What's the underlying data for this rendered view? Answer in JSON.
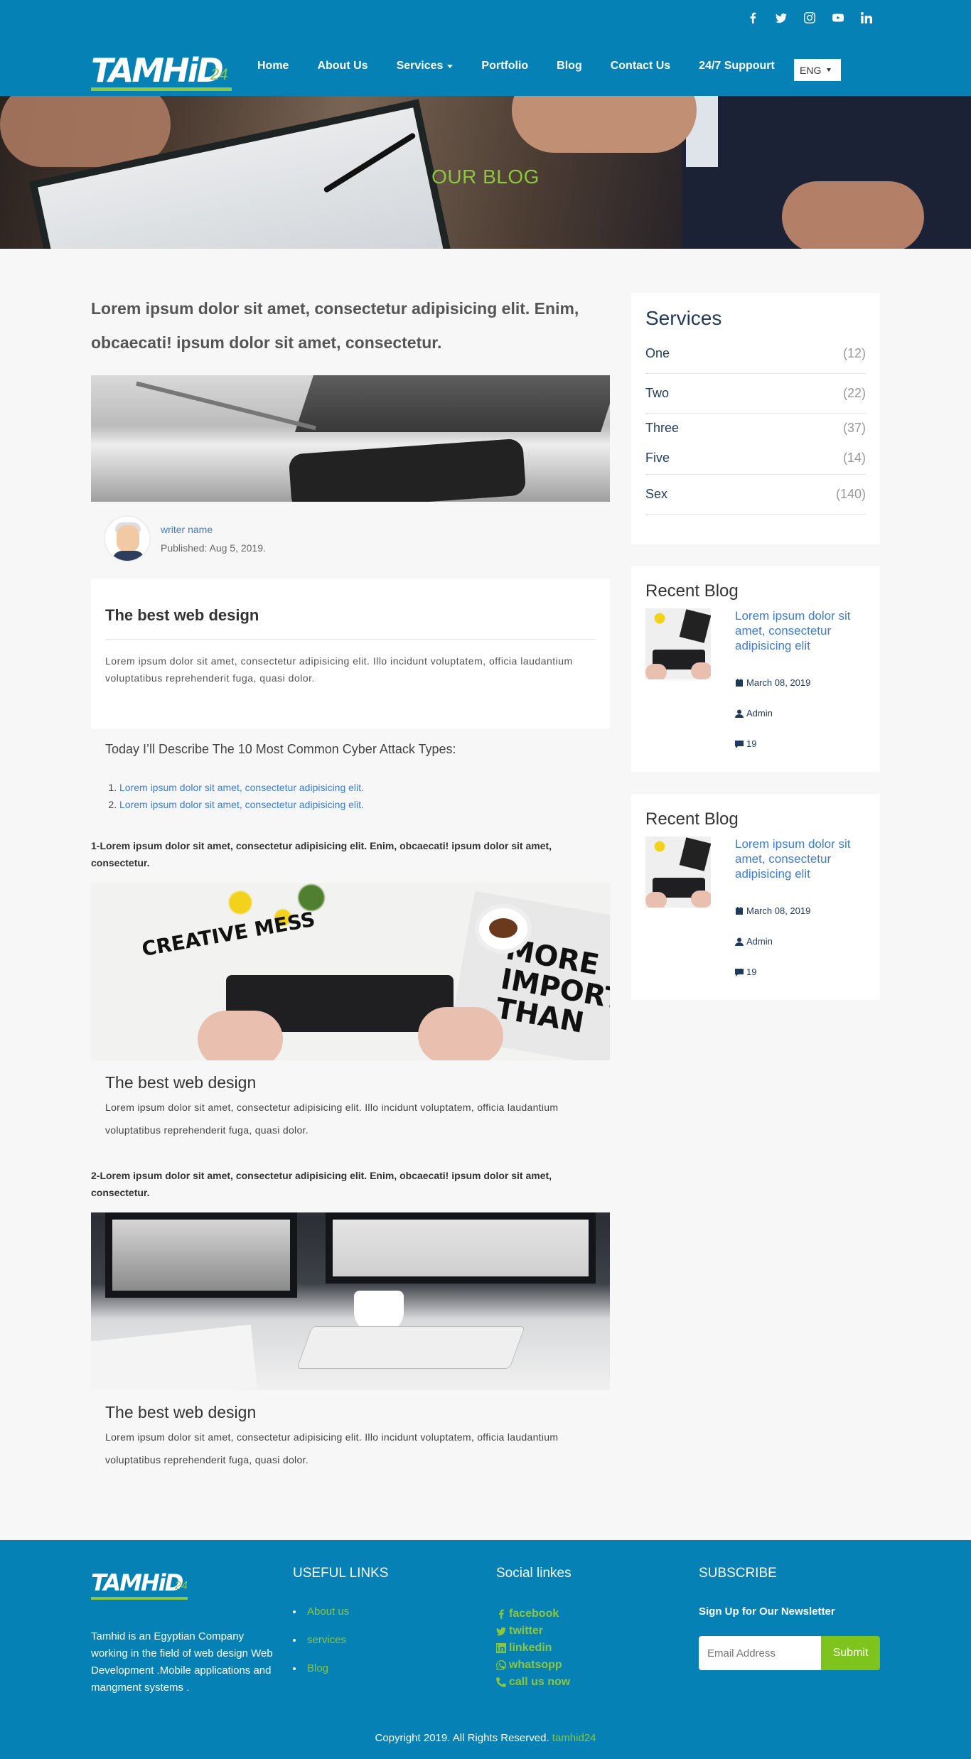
{
  "header": {
    "logo_text": "TAMHiD",
    "logo_sub": "24",
    "social_icons": [
      "facebook-icon",
      "twitter-icon",
      "instagram-icon",
      "youtube-icon",
      "linkedin-icon"
    ],
    "nav": [
      {
        "label": "Home"
      },
      {
        "label": "About Us"
      },
      {
        "label": "Services",
        "has_dropdown": true
      },
      {
        "label": "Portfolio"
      },
      {
        "label": "Blog"
      },
      {
        "label": "Contact Us"
      },
      {
        "label": "24/7 Suppourt"
      }
    ],
    "language": "ENG"
  },
  "hero": {
    "title": "OUR BLOG"
  },
  "post": {
    "title": "Lorem ipsum dolor sit amet, consectetur adipisicing elit. Enim, obcaecati! ipsum dolor sit amet, consectetur.",
    "author_name": "writer name",
    "published": "Published: Aug 5, 2019.",
    "box_title": "The best web design",
    "box_text": "Lorem ipsum dolor sit amet, consectetur adipisicing elit. Illo incidunt voluptatem, officia laudantium voluptatibus reprehenderit fuga, quasi dolor.",
    "describe": "Today I’ll Describe The 10 Most Common Cyber Attack Types:",
    "list": [
      "Lorem ipsum dolor sit amet, consectetur adipisicing elit.",
      "Lorem ipsum dolor sit amet, consectetur adipisicing elit."
    ],
    "sections": [
      {
        "heading": "1-Lorem ipsum dolor sit amet, consectetur adipisicing elit. Enim, obcaecati! ipsum dolor sit amet, consectetur.",
        "image_text_1": "CREATIVE MESS",
        "image_text_2": "MORE IMPORTANT THAN",
        "card_title": "The best web design",
        "card_text": "Lorem ipsum dolor sit amet, consectetur adipisicing elit. Illo incidunt voluptatem, officia laudantium voluptatibus reprehenderit fuga, quasi dolor."
      },
      {
        "heading": "2-Lorem ipsum dolor sit amet, consectetur adipisicing elit. Enim, obcaecati! ipsum dolor sit amet, consectetur.",
        "card_title": "The best web design",
        "card_text": "Lorem ipsum dolor sit amet, consectetur adipisicing elit. Illo incidunt voluptatem, officia laudantium voluptatibus reprehenderit fuga, quasi dolor."
      }
    ]
  },
  "sidebar": {
    "services_title": "Services",
    "services": [
      {
        "name": "One",
        "count": "(12)"
      },
      {
        "name": "Two",
        "count": "(22)"
      },
      {
        "name": "Three",
        "count": "(37)"
      },
      {
        "name": "Five",
        "count": "(14)"
      },
      {
        "name": "Sex",
        "count": "(140)"
      }
    ],
    "recent": [
      {
        "title": "Recent Blog",
        "link": "Lorem ipsum dolor sit amet, consectetur adipisicing elit",
        "date": "March 08, 2019",
        "author": "Admin",
        "comments": "19"
      },
      {
        "title": "Recent Blog",
        "link": "Lorem ipsum dolor sit amet, consectetur adipisicing elit",
        "date": "March 08, 2019",
        "author": "Admin",
        "comments": "19"
      }
    ]
  },
  "footer": {
    "logo_text": "TAMHiD",
    "logo_sub": "24",
    "about": "Tamhid is an Egyptian Company working in the field of web design Web Development .Mobile applications and mangment systems .",
    "useful_title": "USEFUL LINKS",
    "useful_links": [
      "About us",
      "services",
      "Blog"
    ],
    "social_title": "Social linkes",
    "social_links": [
      {
        "label": "facebook",
        "icon": "facebook-icon"
      },
      {
        "label": "twitter",
        "icon": "twitter-icon"
      },
      {
        "label": "linkedin",
        "icon": "linkedin-icon"
      },
      {
        "label": "whatsopp",
        "icon": "whatsapp-icon"
      },
      {
        "label": "call us now",
        "icon": "phone-icon"
      }
    ],
    "subscribe_title": "SUBSCRIBE",
    "subscribe_label": "Sign Up for Our Newsletter",
    "email_placeholder": "Email Address",
    "submit_label": "Submit",
    "copyright": "Copyright 2019. All Rights Reserved.",
    "copyright_brand": "tamhid24"
  },
  "colors": {
    "primary": "#0581b6",
    "accent_green": "#8cc63f",
    "link_blue": "#3b7dd8",
    "navy": "#1f3a5c"
  }
}
